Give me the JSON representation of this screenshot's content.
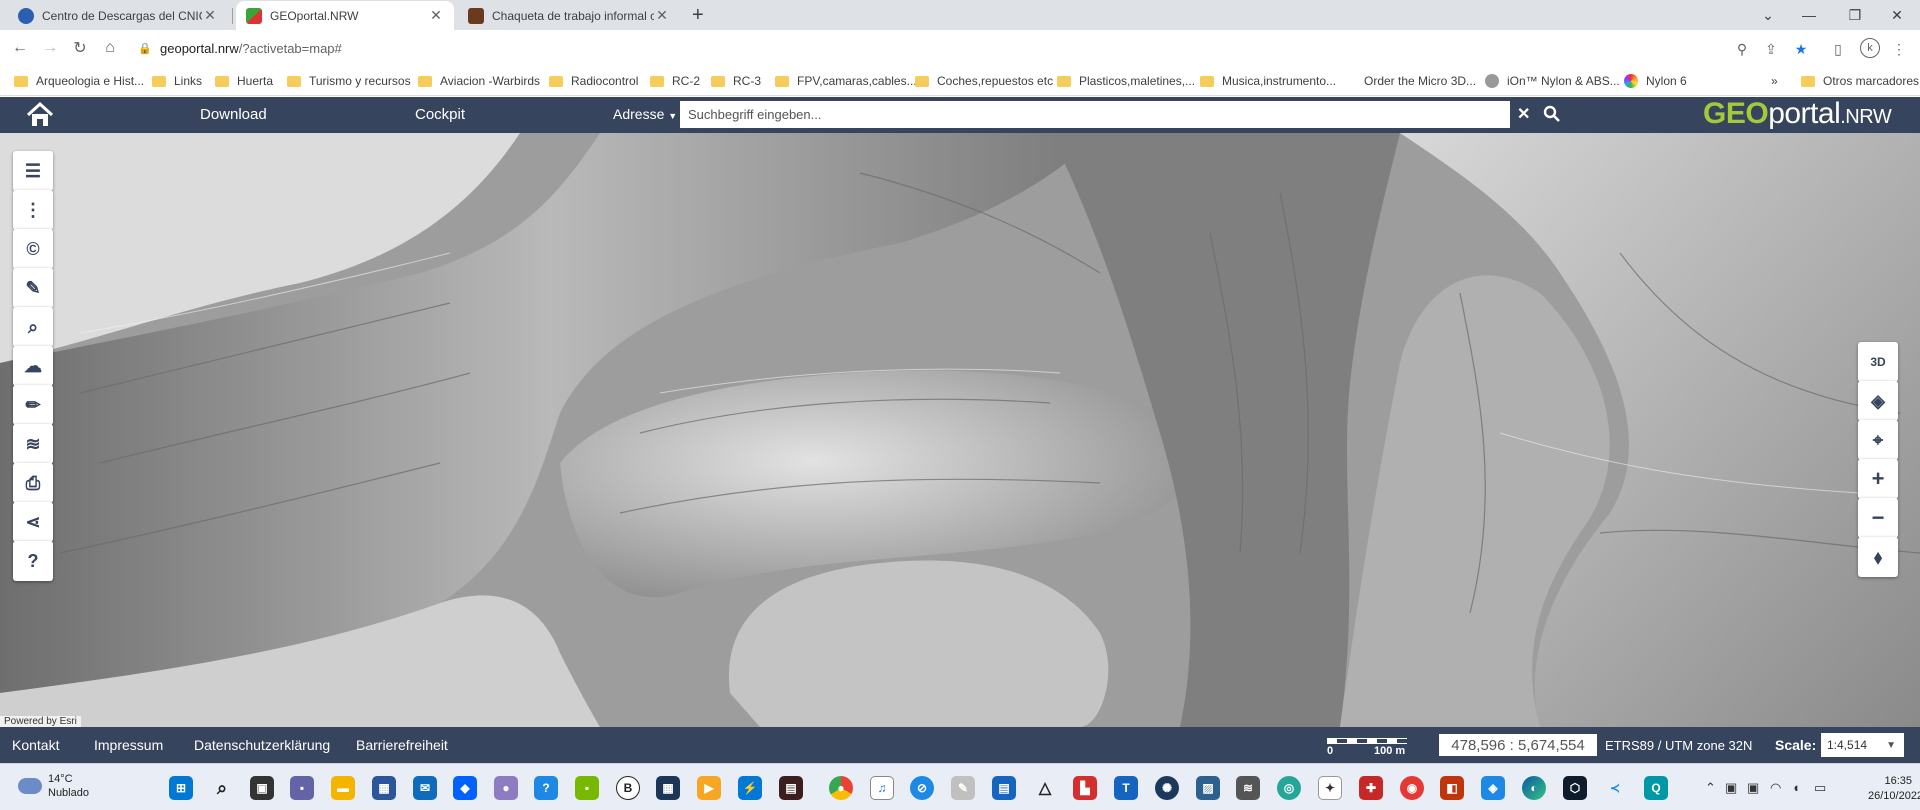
{
  "browser": {
    "tabs": [
      {
        "title": "Centro de Descargas del CNIG (I",
        "favicon_color": "#2b5fb4",
        "favicon": "cnig-icon"
      },
      {
        "title": "GEOportal.NRW",
        "favicon_color": "#3aa33a",
        "favicon": "geoportal-icon"
      },
      {
        "title": "Chaqueta de trabajo informal cá",
        "favicon_color": "#6b3a1e",
        "favicon": "shop-icon"
      }
    ],
    "active_tab": 1,
    "url_host": "geoportal.nrw",
    "url_path": "/?activetab=map#",
    "profile_initial": "k",
    "bookmarks": [
      {
        "label": "Arqueologia e Hist...",
        "type": "folder"
      },
      {
        "label": "Links",
        "type": "folder"
      },
      {
        "label": "Huerta",
        "type": "folder"
      },
      {
        "label": "Turismo y recursos",
        "type": "folder"
      },
      {
        "label": "Aviacion -Warbirds",
        "type": "folder"
      },
      {
        "label": "Radiocontrol",
        "type": "folder"
      },
      {
        "label": "RC-2",
        "type": "folder"
      },
      {
        "label": "RC-3",
        "type": "folder"
      },
      {
        "label": "FPV,camaras,cables....",
        "type": "folder"
      },
      {
        "label": "Coches,repuestos etc",
        "type": "folder"
      },
      {
        "label": "Plasticos,maletines,...",
        "type": "folder"
      },
      {
        "label": "Musica,instrumento...",
        "type": "folder"
      },
      {
        "label": "Order the Micro 3D...",
        "type": "page"
      },
      {
        "label": "iOn™ Nylon & ABS...",
        "type": "page"
      },
      {
        "label": "Nylon 6",
        "type": "page"
      }
    ],
    "bookmarks_overflow": "»",
    "other_bookmarks": "Otros marcadores"
  },
  "geoportal": {
    "nav": {
      "download": "Download",
      "cockpit": "Cockpit"
    },
    "search": {
      "type_label": "Adresse",
      "placeholder": "Suchbegriff eingeben..."
    },
    "logo": {
      "geo": "GEO",
      "portal": "portal",
      "nrw": ".NRW"
    },
    "left_tools": [
      {
        "name": "layer-list-icon",
        "glyph": "☰"
      },
      {
        "name": "more-menu-icon",
        "glyph": "⋮"
      },
      {
        "name": "copyright-icon",
        "glyph": "©"
      },
      {
        "name": "tools-wrench-icon",
        "glyph": "🔧"
      },
      {
        "name": "search-document-icon",
        "glyph": "🔍"
      },
      {
        "name": "download-cloud-icon",
        "glyph": "☁"
      },
      {
        "name": "draw-pencil-icon",
        "glyph": "✎"
      },
      {
        "name": "layer-settings-icon",
        "glyph": "≋"
      },
      {
        "name": "print-icon",
        "glyph": "⎙"
      },
      {
        "name": "share-icon",
        "glyph": "⋖"
      },
      {
        "name": "help-icon",
        "glyph": "?"
      }
    ],
    "right_tools": [
      {
        "name": "3d-view-icon",
        "glyph": "3D"
      },
      {
        "name": "layers-icon",
        "glyph": "◈"
      },
      {
        "name": "locate-me-icon",
        "glyph": "⌖"
      },
      {
        "name": "zoom-in-icon",
        "glyph": "+"
      },
      {
        "name": "zoom-out-icon",
        "glyph": "−"
      },
      {
        "name": "compass-icon",
        "glyph": "⬧"
      }
    ],
    "powered_by": "Powered by Esri",
    "footer": {
      "links": [
        "Kontakt",
        "Impressum",
        "Datenschutzerklärung",
        "Barrierefreiheit"
      ],
      "scalebar": {
        "start": "0",
        "end": "100 m"
      },
      "coordinates": "478,596 : 5,674,554",
      "crs": "ETRS89 / UTM zone 32N",
      "scale_label": "Scale:",
      "scale_value": "1:4,514"
    }
  },
  "taskbar": {
    "weather": {
      "temp": "14°C",
      "condition": "Nublado"
    },
    "time": "16:35",
    "date": "26/10/2022"
  }
}
